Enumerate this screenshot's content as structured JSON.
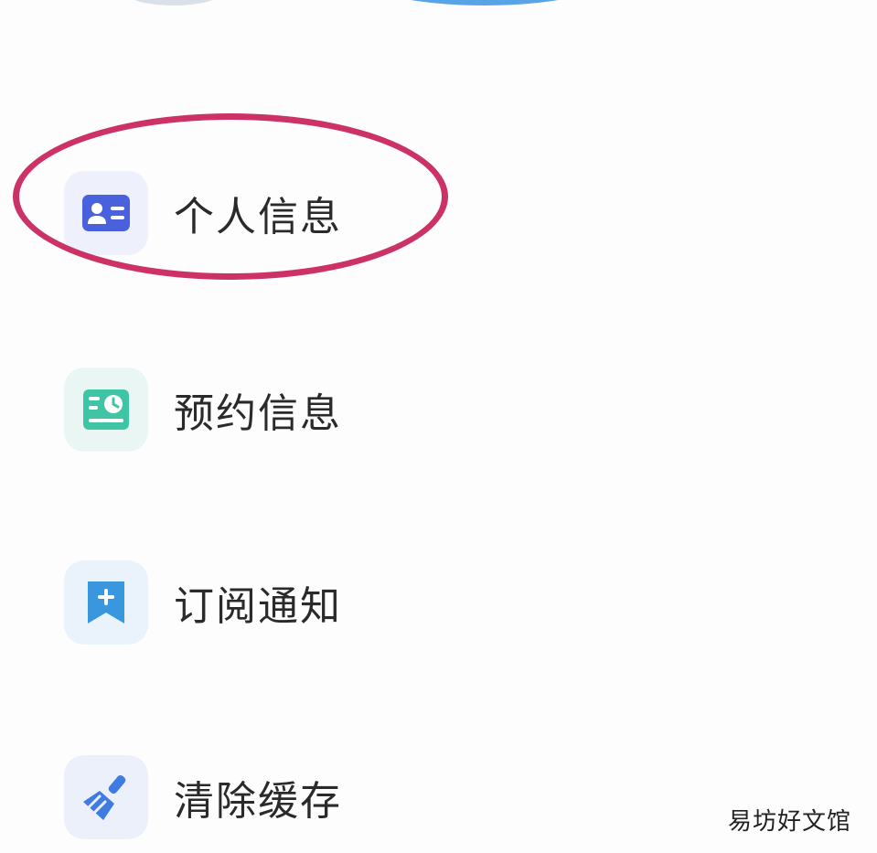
{
  "menu": {
    "items": [
      {
        "label": "个人信息",
        "icon": "id-card-icon",
        "icon_color": "#4a61dd"
      },
      {
        "label": "预约信息",
        "icon": "schedule-board-icon",
        "icon_color": "#3fc5a6"
      },
      {
        "label": "订阅通知",
        "icon": "bookmark-plus-icon",
        "icon_color": "#3a97de"
      },
      {
        "label": "清除缓存",
        "icon": "broom-icon",
        "icon_color": "#3f7be0"
      }
    ]
  },
  "annotation": {
    "highlight_color": "#cc3364",
    "highlighted_item": "个人信息"
  },
  "watermark": {
    "text": "易坊好文馆"
  }
}
